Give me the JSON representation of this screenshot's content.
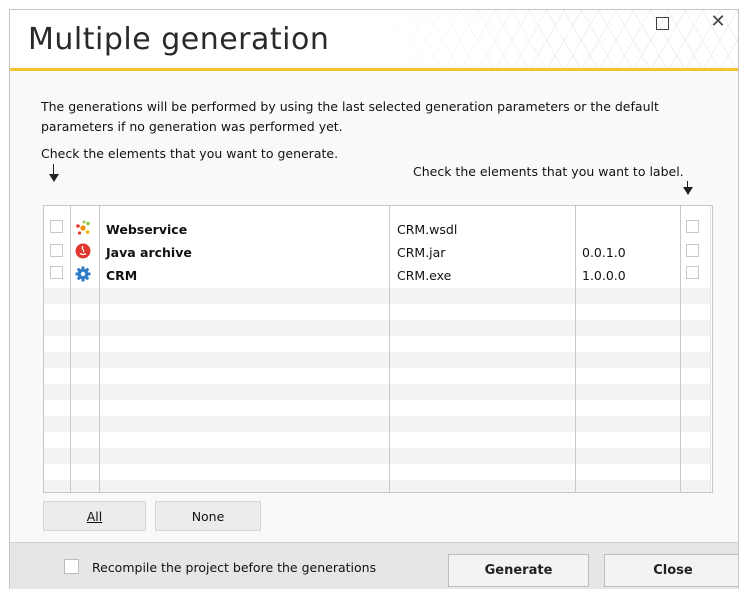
{
  "window": {
    "title": "Multiple generation",
    "maximize_label": "",
    "close_symbol": "✕"
  },
  "instructions": {
    "intro": "The generations will be performed by using the last selected generation parameters or the default parameters if no generation was performed yet.",
    "check_generate": "Check the elements that you want to generate.",
    "check_label": "Check the elements that you want to label."
  },
  "elements": [
    {
      "name": "Webservice",
      "file": "CRM.wsdl",
      "version": "",
      "icon": "webservice-icon",
      "generate_checked": false,
      "label_checked": false
    },
    {
      "name": "Java archive",
      "file": "CRM.jar",
      "version": "0.0.1.0",
      "icon": "java-icon",
      "generate_checked": false,
      "label_checked": false
    },
    {
      "name": "CRM",
      "file": "CRM.exe",
      "version": "1.0.0.0",
      "icon": "gear-icon",
      "generate_checked": false,
      "label_checked": false
    }
  ],
  "selection_buttons": {
    "all": "All",
    "none": "None"
  },
  "footer": {
    "recompile_label": "Recompile the project before the generations",
    "recompile_checked": false,
    "generate": "Generate",
    "close": "Close"
  },
  "colors": {
    "accent": "#f4c430",
    "stripe": "#f3f3f3"
  }
}
